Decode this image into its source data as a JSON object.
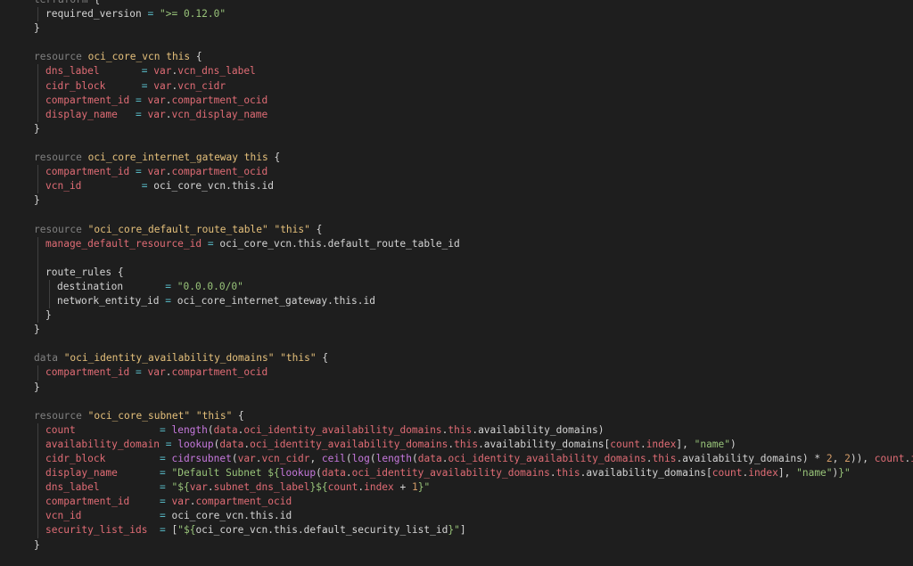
{
  "theme": {
    "background": "#1e1e1e",
    "colors": {
      "kw": "#808080",
      "type": "#e5c07b",
      "key": "#e06c75",
      "op": "#56b6c2",
      "var": "#e06c75",
      "str": "#98c379",
      "num": "#d19a66",
      "fn": "#c678dd",
      "plain": "#d4d4d4"
    }
  },
  "code_lines": [
    {
      "indent": 0,
      "tokens": [
        [
          "kw",
          "terraform"
        ],
        [
          "punc",
          " {"
        ]
      ]
    },
    {
      "indent": 1,
      "tokens": [
        [
          "plain",
          "required_version"
        ],
        [
          "op",
          " = "
        ],
        [
          "str",
          "\">= 0.12.0\""
        ]
      ]
    },
    {
      "indent": 0,
      "tokens": [
        [
          "punc",
          "}"
        ]
      ]
    },
    {
      "indent": 0,
      "tokens": []
    },
    {
      "indent": 0,
      "tokens": [
        [
          "kw",
          "resource "
        ],
        [
          "type",
          "oci_core_vcn"
        ],
        [
          "punc",
          " "
        ],
        [
          "type",
          "this"
        ],
        [
          "punc",
          " {"
        ]
      ]
    },
    {
      "indent": 1,
      "tokens": [
        [
          "key",
          "dns_label      "
        ],
        [
          "op",
          " = "
        ],
        [
          "var",
          "var"
        ],
        [
          "punc",
          "."
        ],
        [
          "var",
          "vcn_dns_label"
        ]
      ]
    },
    {
      "indent": 1,
      "tokens": [
        [
          "key",
          "cidr_block     "
        ],
        [
          "op",
          " = "
        ],
        [
          "var",
          "var"
        ],
        [
          "punc",
          "."
        ],
        [
          "var",
          "vcn_cidr"
        ]
      ]
    },
    {
      "indent": 1,
      "tokens": [
        [
          "key",
          "compartment_id "
        ],
        [
          "op",
          "= "
        ],
        [
          "var",
          "var"
        ],
        [
          "punc",
          "."
        ],
        [
          "var",
          "compartment_ocid"
        ]
      ]
    },
    {
      "indent": 1,
      "tokens": [
        [
          "key",
          "display_name   "
        ],
        [
          "op",
          "= "
        ],
        [
          "var",
          "var"
        ],
        [
          "punc",
          "."
        ],
        [
          "var",
          "vcn_display_name"
        ]
      ]
    },
    {
      "indent": 0,
      "tokens": [
        [
          "punc",
          "}"
        ]
      ]
    },
    {
      "indent": 0,
      "tokens": []
    },
    {
      "indent": 0,
      "tokens": [
        [
          "kw",
          "resource "
        ],
        [
          "type",
          "oci_core_internet_gateway"
        ],
        [
          "punc",
          " "
        ],
        [
          "type",
          "this"
        ],
        [
          "punc",
          " {"
        ]
      ]
    },
    {
      "indent": 1,
      "tokens": [
        [
          "key",
          "compartment_id "
        ],
        [
          "op",
          "= "
        ],
        [
          "var",
          "var"
        ],
        [
          "punc",
          "."
        ],
        [
          "var",
          "compartment_ocid"
        ]
      ]
    },
    {
      "indent": 1,
      "tokens": [
        [
          "key",
          "vcn_id         "
        ],
        [
          "op",
          " = "
        ],
        [
          "plain",
          "oci_core_vcn.this.id"
        ]
      ]
    },
    {
      "indent": 0,
      "tokens": [
        [
          "punc",
          "}"
        ]
      ]
    },
    {
      "indent": 0,
      "tokens": []
    },
    {
      "indent": 0,
      "tokens": [
        [
          "kw",
          "resource "
        ],
        [
          "type",
          "\"oci_core_default_route_table\""
        ],
        [
          "punc",
          " "
        ],
        [
          "type",
          "\"this\""
        ],
        [
          "punc",
          " {"
        ]
      ]
    },
    {
      "indent": 1,
      "tokens": [
        [
          "key",
          "manage_default_resource_id "
        ],
        [
          "op",
          "= "
        ],
        [
          "plain",
          "oci_core_vcn.this.default_route_table_id"
        ]
      ]
    },
    {
      "indent": 1,
      "tokens": []
    },
    {
      "indent": 1,
      "tokens": [
        [
          "plain",
          "route_rules"
        ],
        [
          "punc",
          " {"
        ]
      ]
    },
    {
      "indent": 2,
      "tokens": [
        [
          "plain",
          "destination       "
        ],
        [
          "op",
          "= "
        ],
        [
          "str",
          "\"0.0.0.0/0\""
        ]
      ]
    },
    {
      "indent": 2,
      "tokens": [
        [
          "plain",
          "network_entity_id "
        ],
        [
          "op",
          "= "
        ],
        [
          "plain",
          "oci_core_internet_gateway.this.id"
        ]
      ]
    },
    {
      "indent": 1,
      "tokens": [
        [
          "punc",
          "}"
        ]
      ]
    },
    {
      "indent": 0,
      "tokens": [
        [
          "punc",
          "}"
        ]
      ]
    },
    {
      "indent": 0,
      "tokens": []
    },
    {
      "indent": 0,
      "tokens": [
        [
          "kw",
          "data "
        ],
        [
          "type",
          "\"oci_identity_availability_domains\""
        ],
        [
          "punc",
          " "
        ],
        [
          "type",
          "\"this\""
        ],
        [
          "punc",
          " {"
        ]
      ]
    },
    {
      "indent": 1,
      "tokens": [
        [
          "key",
          "compartment_id "
        ],
        [
          "op",
          "= "
        ],
        [
          "var",
          "var"
        ],
        [
          "punc",
          "."
        ],
        [
          "var",
          "compartment_ocid"
        ]
      ]
    },
    {
      "indent": 0,
      "tokens": [
        [
          "punc",
          "}"
        ]
      ]
    },
    {
      "indent": 0,
      "tokens": []
    },
    {
      "indent": 0,
      "tokens": [
        [
          "kw",
          "resource "
        ],
        [
          "type",
          "\"oci_core_subnet\""
        ],
        [
          "punc",
          " "
        ],
        [
          "type",
          "\"this\""
        ],
        [
          "punc",
          " {"
        ]
      ]
    },
    {
      "indent": 1,
      "tokens": [
        [
          "key",
          "count              "
        ],
        [
          "op",
          "= "
        ],
        [
          "fn",
          "length"
        ],
        [
          "punc",
          "("
        ],
        [
          "var",
          "data"
        ],
        [
          "punc",
          "."
        ],
        [
          "var",
          "oci_identity_availability_domains"
        ],
        [
          "punc",
          "."
        ],
        [
          "var",
          "this"
        ],
        [
          "punc",
          ".availability_domains)"
        ]
      ]
    },
    {
      "indent": 1,
      "tokens": [
        [
          "key",
          "availability_domain "
        ],
        [
          "op",
          "= "
        ],
        [
          "fn",
          "lookup"
        ],
        [
          "punc",
          "("
        ],
        [
          "var",
          "data"
        ],
        [
          "punc",
          "."
        ],
        [
          "var",
          "oci_identity_availability_domains"
        ],
        [
          "punc",
          "."
        ],
        [
          "var",
          "this"
        ],
        [
          "punc",
          ".availability_domains["
        ],
        [
          "var",
          "count"
        ],
        [
          "punc",
          "."
        ],
        [
          "var",
          "index"
        ],
        [
          "punc",
          "], "
        ],
        [
          "str",
          "\"name\""
        ],
        [
          "punc",
          ")"
        ]
      ]
    },
    {
      "indent": 1,
      "tokens": [
        [
          "key",
          "cidr_block         "
        ],
        [
          "op",
          "= "
        ],
        [
          "fn",
          "cidrsubnet"
        ],
        [
          "punc",
          "("
        ],
        [
          "var",
          "var"
        ],
        [
          "punc",
          "."
        ],
        [
          "var",
          "vcn_cidr"
        ],
        [
          "punc",
          ", "
        ],
        [
          "fn",
          "ceil"
        ],
        [
          "punc",
          "("
        ],
        [
          "fn",
          "log"
        ],
        [
          "punc",
          "("
        ],
        [
          "fn",
          "length"
        ],
        [
          "punc",
          "("
        ],
        [
          "var",
          "data"
        ],
        [
          "punc",
          "."
        ],
        [
          "var",
          "oci_identity_availability_domains"
        ],
        [
          "punc",
          "."
        ],
        [
          "var",
          "this"
        ],
        [
          "punc",
          ".availability_domains) * "
        ],
        [
          "num",
          "2"
        ],
        [
          "punc",
          ", "
        ],
        [
          "num",
          "2"
        ],
        [
          "punc",
          ")), "
        ],
        [
          "var",
          "count"
        ],
        [
          "punc",
          "."
        ],
        [
          "var",
          "index"
        ],
        [
          "punc",
          ")"
        ]
      ]
    },
    {
      "indent": 1,
      "tokens": [
        [
          "key",
          "display_name       "
        ],
        [
          "op",
          "= "
        ],
        [
          "str",
          "\"Default Subnet ${"
        ],
        [
          "fn",
          "lookup"
        ],
        [
          "punc",
          "("
        ],
        [
          "var",
          "data"
        ],
        [
          "punc",
          "."
        ],
        [
          "var",
          "oci_identity_availability_domains"
        ],
        [
          "punc",
          "."
        ],
        [
          "var",
          "this"
        ],
        [
          "punc",
          ".availability_domains["
        ],
        [
          "var",
          "count"
        ],
        [
          "punc",
          "."
        ],
        [
          "var",
          "index"
        ],
        [
          "punc",
          "], "
        ],
        [
          "str",
          "\"name\""
        ],
        [
          "punc",
          ")"
        ],
        [
          "str",
          "}\""
        ]
      ]
    },
    {
      "indent": 1,
      "tokens": [
        [
          "key",
          "dns_label          "
        ],
        [
          "op",
          "= "
        ],
        [
          "str",
          "\"${"
        ],
        [
          "var",
          "var"
        ],
        [
          "punc",
          "."
        ],
        [
          "var",
          "subnet_dns_label"
        ],
        [
          "str",
          "}${"
        ],
        [
          "var",
          "count"
        ],
        [
          "punc",
          "."
        ],
        [
          "var",
          "index"
        ],
        [
          "punc",
          " + "
        ],
        [
          "num",
          "1"
        ],
        [
          "str",
          "}\""
        ]
      ]
    },
    {
      "indent": 1,
      "tokens": [
        [
          "key",
          "compartment_id     "
        ],
        [
          "op",
          "= "
        ],
        [
          "var",
          "var"
        ],
        [
          "punc",
          "."
        ],
        [
          "var",
          "compartment_ocid"
        ]
      ]
    },
    {
      "indent": 1,
      "tokens": [
        [
          "key",
          "vcn_id             "
        ],
        [
          "op",
          "= "
        ],
        [
          "plain",
          "oci_core_vcn.this.id"
        ]
      ]
    },
    {
      "indent": 1,
      "tokens": [
        [
          "key",
          "security_list_ids  "
        ],
        [
          "op",
          "= "
        ],
        [
          "punc",
          "["
        ],
        [
          "str",
          "\"${"
        ],
        [
          "plain",
          "oci_core_vcn.this.default_security_list_id"
        ],
        [
          "str",
          "}\""
        ],
        [
          "punc",
          "]"
        ]
      ]
    },
    {
      "indent": 0,
      "tokens": [
        [
          "punc",
          "}"
        ]
      ]
    }
  ]
}
